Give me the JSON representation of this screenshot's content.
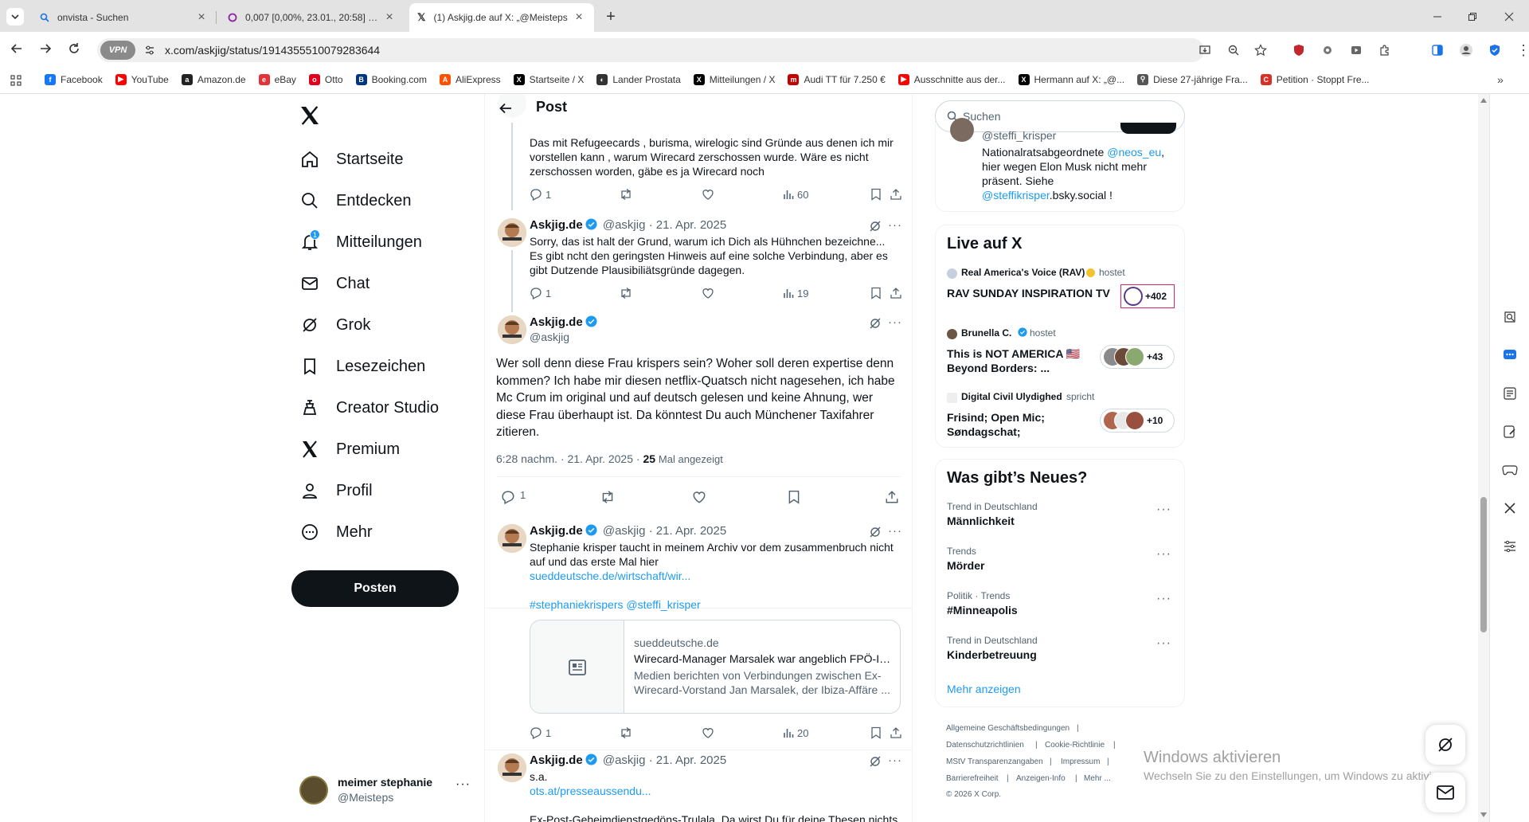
{
  "browser": {
    "tabs": [
      {
        "title": "onvista - Suchen"
      },
      {
        "title": "0,007 [0,00%, 23.01., 20:58] Wir..."
      },
      {
        "title": "(1) Askjig.de auf X: „@Meisteps"
      }
    ],
    "vpn_label": "VPN",
    "url": "x.com/askjig/status/1914355510079283644",
    "bookmarks": [
      {
        "label": "Facebook",
        "color": "#1877f2",
        "glyph": "f"
      },
      {
        "label": "YouTube",
        "color": "#ff0000",
        "glyph": "▶"
      },
      {
        "label": "Amazon.de",
        "color": "#222222",
        "glyph": "a"
      },
      {
        "label": "eBay",
        "color": "#e53238",
        "glyph": "e"
      },
      {
        "label": "Otto",
        "color": "#e2001a",
        "glyph": "o"
      },
      {
        "label": "Booking.com",
        "color": "#003580",
        "glyph": "B"
      },
      {
        "label": "AliExpress",
        "color": "#ff4f00",
        "glyph": "A"
      },
      {
        "label": "Startseite / X",
        "color": "#000000",
        "glyph": "X"
      },
      {
        "label": "Lander Prostata",
        "color": "#333333",
        "glyph": "◐"
      },
      {
        "label": "Mitteilungen / X",
        "color": "#000000",
        "glyph": "X"
      },
      {
        "label": "Audi TT für 7.250 €",
        "color": "#c40000",
        "glyph": "m"
      },
      {
        "label": "Ausschnitte aus der...",
        "color": "#ff0000",
        "glyph": "▶"
      },
      {
        "label": "Hermann auf X: „@...",
        "color": "#000000",
        "glyph": "X"
      },
      {
        "label": "Diese 27-jährige Fra...",
        "color": "#555555",
        "glyph": "⚲"
      },
      {
        "label": "Petition · Stoppt Fre...",
        "color": "#d93025",
        "glyph": "C"
      }
    ]
  },
  "nav": {
    "items": [
      "Startseite",
      "Entdecken",
      "Mitteilungen",
      "Chat",
      "Grok",
      "Lesezeichen",
      "Creator Studio",
      "Premium",
      "Profil",
      "Mehr"
    ],
    "notification_count": "1",
    "post_button": "Posten",
    "account": {
      "name": "meimer stephanie",
      "handle": "@Meisteps"
    }
  },
  "main": {
    "header_title": "Post",
    "tweet_prev": {
      "text": "Das mit Refugeecards , burisma, wirelogic sind Gründe aus denen ich mir vorstellen kann , warum Wirecard zerschossen wurde. Wäre es nicht zerschossen worden, gäbe es ja Wirecard noch",
      "replies": "1",
      "views": "60"
    },
    "tweet_reply1": {
      "name": "Askjig.de",
      "handle": "@askjig",
      "date": "· 21. Apr. 2025",
      "text": "Sorry, das ist halt der Grund, warum ich Dich als Hühnchen bezeichne... Es gibt ncht den geringsten Hinweis auf eine solche Verbindung, aber es gibt Dutzende Plausibiliätsgründe dagegen.",
      "replies": "1",
      "views": "19"
    },
    "focused": {
      "name": "Askjig.de",
      "handle": "@askjig",
      "text": "Wer soll denn diese Frau krispers sein? Woher soll deren expertise denn kommen? Ich habe mir diesen netflix-Quatsch nicht nagesehen, ich habe Mc Crum im original und auf deutsch gelesen und keine Ahnung, wer diese Frau überhaupt ist. Da könntest Du auch Münchener Taxifahrer zitieren.",
      "time": "6:28 nachm. · 21. Apr. 2025 ·",
      "views_count": "25",
      "views_label": "Mal angezeigt",
      "replies": "1"
    },
    "tweet_reply2": {
      "name": "Askjig.de",
      "handle": "@askjig",
      "date": "· 21. Apr. 2025",
      "text": "Stephanie krisper taucht in meinem Archiv vor dem zusammenbruch nicht auf und das erste Mal hier",
      "link": "sueddeutsche.de/wirtschaft/wir...",
      "tags": "#stephaniekrispers @steffi_krisper",
      "card": {
        "domain": "sueddeutsche.de",
        "title": "Wirecard-Manager Marsalek war angeblich FPÖ-In...",
        "desc": "Medien berichten von Verbindungen zwischen Ex-Wirecard-Vorstand Jan Marsalek, der Ibiza-Affäre ..."
      },
      "replies": "1",
      "views": "20"
    },
    "tweet_reply3": {
      "name": "Askjig.de",
      "handle": "@askjig",
      "date": "· 21. Apr. 2025",
      "text": "s.a.",
      "link": "ots.at/presseaussendu...",
      "more": "Ex-Post-Geheimdienstgedöns-Trulala. Da wirst Du für deine Thesen nichts"
    }
  },
  "right": {
    "search_placeholder": "Suchen",
    "who": {
      "handle": "@steffi_krisper",
      "bio1": "Nationalratsabgeordnete ",
      "bio_link": "@neos_eu",
      "bio2": ", hier wegen Elon Musk nicht mehr präsent. Siehe ",
      "bio_link2": "@steffikrisper",
      "bio3": ".bsky.social !"
    },
    "live": {
      "title": "Live auf X",
      "items": [
        {
          "host": "Real America's Voice (RAV)",
          "role": "hostet",
          "title": "RAV SUNDAY INSPIRATION TV",
          "count": "+402"
        },
        {
          "host": "Brunella C.",
          "role": "hostet",
          "title": "This is NOT AMERICA 🇺🇸 Beyond Borders: ...",
          "count": "+43"
        },
        {
          "host": "Digital Civil Ulydighed",
          "role": "spricht",
          "title": "Frisind; Open Mic; Søndagschat;",
          "count": "+10"
        }
      ]
    },
    "news": {
      "title": "Was gibt’s Neues?",
      "trends": [
        {
          "context": "Trend in Deutschland",
          "name": "Männlichkeit"
        },
        {
          "context": "Trends",
          "name": "Mörder"
        },
        {
          "context": "Politik · Trends",
          "name": "#Minneapolis"
        },
        {
          "context": "Trend in Deutschland",
          "name": "Kinderbetreuung"
        }
      ],
      "more": "Mehr anzeigen"
    },
    "footer": [
      "Allgemeine Geschäftsbedingungen",
      "Datenschutzrichtlinien",
      "Cookie-Richtlinie",
      "MStV Transparenzangaben",
      "Impressum",
      "Barrierefreiheit",
      "Anzeigen-Info",
      "Mehr ...",
      "© 2026 X Corp."
    ]
  },
  "windows": {
    "title": "Windows aktivieren",
    "subtitle": "Wechseln Sie zu den Einstellungen, um Windows zu aktivieren."
  },
  "colors": {
    "accent": "#1d9bf0",
    "text": "#0f1419",
    "muted": "#536471"
  }
}
